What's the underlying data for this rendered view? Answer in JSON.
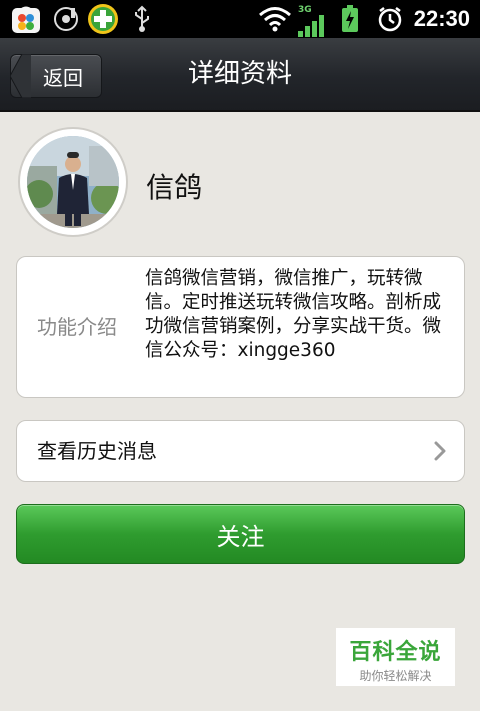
{
  "status_bar": {
    "time": "22:30",
    "network_label": "3G",
    "icons": [
      "app-store-icon",
      "music-icon",
      "plus-shield-icon",
      "usb-icon",
      "wifi-icon",
      "signal-icon",
      "battery-charging-icon",
      "alarm-icon"
    ]
  },
  "header": {
    "back_label": "返回",
    "title": "详细资料"
  },
  "profile": {
    "name": "信鸽"
  },
  "intro": {
    "label": "功能介绍",
    "text": "信鸽微信营销，微信推广，玩转微信。定时推送玩转微信攻略。剖析成功微信营销案例，分享实战干货。微信公众号：xingge360"
  },
  "history": {
    "label": "查看历史消息"
  },
  "follow_button": {
    "label": "关注"
  },
  "watermark": {
    "main": "百科全说",
    "sub": "助你轻松解决"
  },
  "colors": {
    "accent_green": "#2f9c2f",
    "titlebar": "#22252a",
    "background": "#e9e7e2"
  }
}
